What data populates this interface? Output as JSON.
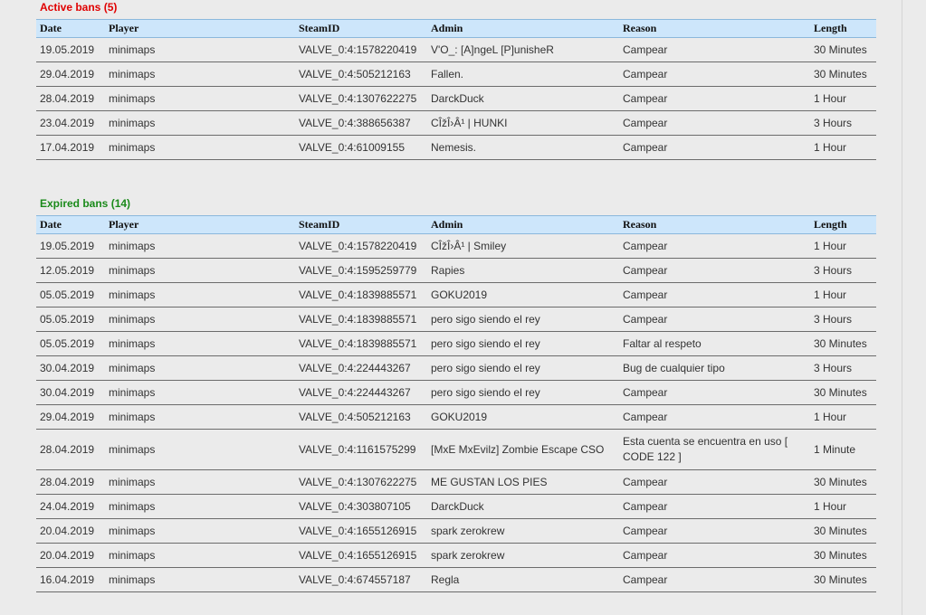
{
  "active": {
    "title": "Active bans (5)",
    "headers": [
      "Date",
      "Player",
      "SteamID",
      "Admin",
      "Reason",
      "Length"
    ],
    "rows": [
      [
        "19.05.2019",
        "minimaps",
        "VALVE_0:4:1578220419",
        "V'O_: [A]ngeL [P]unisheR",
        "Campear",
        "30 Minutes"
      ],
      [
        "29.04.2019",
        "minimaps",
        "VALVE_0:4:505212163",
        "Fallen.",
        "Campear",
        "30 Minutes"
      ],
      [
        "28.04.2019",
        "minimaps",
        "VALVE_0:4:1307622275",
        "DarckDuck",
        "Campear",
        "1 Hour"
      ],
      [
        "23.04.2019",
        "minimaps",
        "VALVE_0:4:388656387",
        "CÎžÎ›Â¹ | HUNKI",
        "Campear",
        "3 Hours"
      ],
      [
        "17.04.2019",
        "minimaps",
        "VALVE_0:4:61009155",
        "Nemesis.",
        "Campear",
        "1 Hour"
      ]
    ]
  },
  "expired": {
    "title": "Expired bans (14)",
    "headers": [
      "Date",
      "Player",
      "SteamID",
      "Admin",
      "Reason",
      "Length"
    ],
    "rows": [
      [
        "19.05.2019",
        "minimaps",
        "VALVE_0:4:1578220419",
        "CÎžÎ›Â¹ | Smiley",
        "Campear",
        "1 Hour"
      ],
      [
        "12.05.2019",
        "minimaps",
        "VALVE_0:4:1595259779",
        "Rapies",
        "Campear",
        "3 Hours"
      ],
      [
        "05.05.2019",
        "minimaps",
        "VALVE_0:4:1839885571",
        "GOKU2019",
        "Campear",
        "1 Hour"
      ],
      [
        "05.05.2019",
        "minimaps",
        "VALVE_0:4:1839885571",
        "pero sigo siendo el rey",
        "Campear",
        "3 Hours"
      ],
      [
        "05.05.2019",
        "minimaps",
        "VALVE_0:4:1839885571",
        "pero sigo siendo el rey",
        "Faltar al respeto",
        "30 Minutes"
      ],
      [
        "30.04.2019",
        "minimaps",
        "VALVE_0:4:224443267",
        "pero sigo siendo el rey",
        "Bug de cualquier tipo",
        "3 Hours"
      ],
      [
        "30.04.2019",
        "minimaps",
        "VALVE_0:4:224443267",
        "pero sigo siendo el rey",
        "Campear",
        "30 Minutes"
      ],
      [
        "29.04.2019",
        "minimaps",
        "VALVE_0:4:505212163",
        "GOKU2019",
        "Campear",
        "1 Hour"
      ],
      [
        "28.04.2019",
        "minimaps",
        "VALVE_0:4:1161575299",
        "[MxE MxEvilz] Zombie Escape CSO",
        "Esta cuenta se encuentra en uso [ CODE 122 ]",
        "1 Minute"
      ],
      [
        "28.04.2019",
        "minimaps",
        "VALVE_0:4:1307622275",
        "ME GUSTAN LOS PIES",
        "Campear",
        "30 Minutes"
      ],
      [
        "24.04.2019",
        "minimaps",
        "VALVE_0:4:303807105",
        "DarckDuck",
        "Campear",
        "1 Hour"
      ],
      [
        "20.04.2019",
        "minimaps",
        "VALVE_0:4:1655126915",
        "spark zerokrew",
        "Campear",
        "30 Minutes"
      ],
      [
        "20.04.2019",
        "minimaps",
        "VALVE_0:4:1655126915",
        "spark zerokrew",
        "Campear",
        "30 Minutes"
      ],
      [
        "16.04.2019",
        "minimaps",
        "VALVE_0:4:674557187",
        "Regla",
        "Campear",
        "30 Minutes"
      ]
    ]
  }
}
